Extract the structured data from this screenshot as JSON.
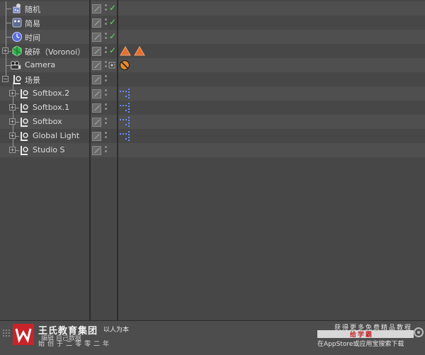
{
  "objects": [
    {
      "label": "随机",
      "icon": "random-effector-icon"
    },
    {
      "label": "简易",
      "icon": "plain-effector-icon"
    },
    {
      "label": "时间",
      "icon": "time-effector-icon"
    },
    {
      "label": "破碎（Voronoi）",
      "icon": "voronoi-fracture-icon"
    },
    {
      "label": "Camera",
      "icon": "camera-icon"
    },
    {
      "label": "场景",
      "icon": "null-object-icon"
    },
    {
      "label": "Softbox.2",
      "icon": "null-object-icon"
    },
    {
      "label": "Softbox.1",
      "icon": "null-object-icon"
    },
    {
      "label": "Softbox",
      "icon": "null-object-icon"
    },
    {
      "label": "Global Light",
      "icon": "null-object-icon"
    },
    {
      "label": "Studio S",
      "icon": "null-object-icon"
    }
  ],
  "watermark": {
    "brand_title": "王氏教育集团",
    "brand_slogan": "以人为本",
    "brand_under": "编辑    自己数据",
    "brand_sub": "始创于二零零二年",
    "promo_top": "获得更多免费精品教程",
    "promo_bar_label": "给学霸",
    "promo_bottom": "在AppStore或应用宝搜索下载"
  },
  "colors": {
    "check": "#5fe05f",
    "tag_orange": "#e07030",
    "tag_blue_dots": "#6a8cff",
    "brand_red": "#c8242a"
  }
}
